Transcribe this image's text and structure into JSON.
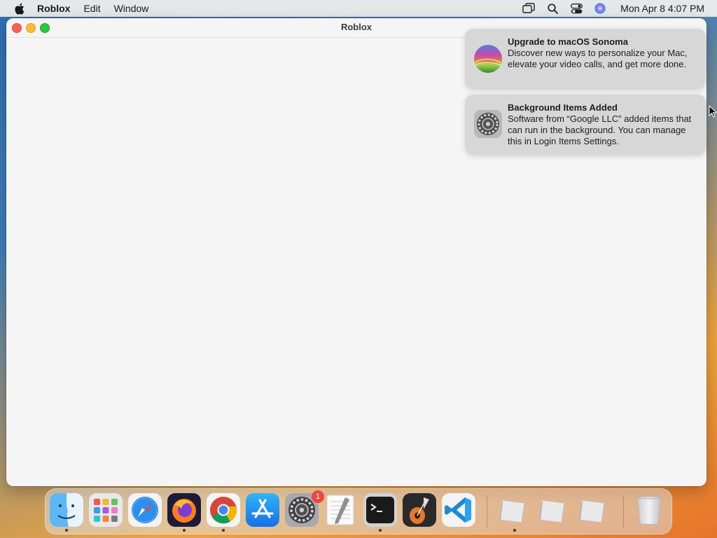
{
  "menubar": {
    "apple_icon": "apple-logo-icon",
    "app_name": "Roblox",
    "menus": [
      "Edit",
      "Window"
    ],
    "status_icons": [
      "screen-mirroring-icon",
      "search-icon",
      "control-center-icon",
      "siri-icon"
    ],
    "clock": "Mon Apr 8  4:07 PM"
  },
  "window": {
    "title": "Roblox"
  },
  "notifications": [
    {
      "title": "Upgrade to macOS Sonoma",
      "body": "Discover new ways to personalize your Mac, elevate your video calls, and get more done.",
      "icon": "macos-sonoma-icon"
    },
    {
      "title": "Background Items Added",
      "body": "Software from “Google LLC” added items that can run in the background. You can manage this in Login Items Settings.",
      "icon": "system-settings-icon"
    }
  ],
  "dock": {
    "apps": [
      "Finder",
      "Launchpad",
      "Safari",
      "Firefox",
      "Google Chrome",
      "App Store",
      "System Settings",
      "TextEdit",
      "Terminal",
      "GarageBand",
      "Visual Studio Code"
    ],
    "system_settings_badge": "1",
    "recent": [
      "Roblox",
      "Roblox",
      "Roblox"
    ],
    "trash": "Trash"
  },
  "colors": {
    "close": "#fe5f57",
    "minimize": "#febc2e",
    "zoom": "#28c840",
    "badge": "#f2453d"
  }
}
